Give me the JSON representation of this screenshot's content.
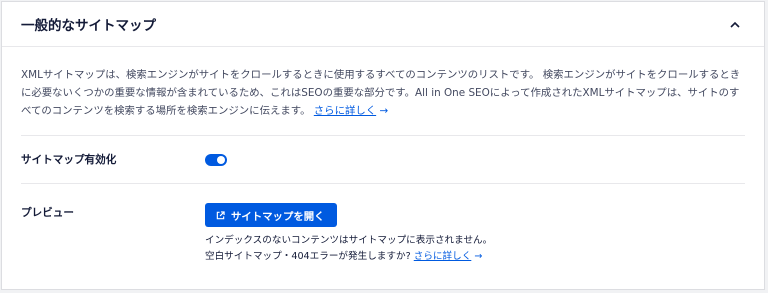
{
  "header": {
    "title": "一般的なサイトマップ"
  },
  "description": {
    "text": "XMLサイトマップは、検索エンジンがサイトをクロールするときに使用するすべてのコンテンツのリストです。 検索エンジンがサイトをクロールするときに必要ないくつかの重要な情報が含まれているため、これはSEOの重要な部分です。All in One SEOによって作成されたXMLサイトマップは、サイトのすべてのコンテンツを検索する場所を検索エンジンに伝えます。",
    "link": "さらに詳しく",
    "arrow": "→"
  },
  "enable_sitemap": {
    "label": "サイトマップ有効化",
    "enabled": true
  },
  "preview": {
    "label": "プレビュー",
    "button_label": "サイトマップを開く",
    "help_line1": "インデックスのないコンテンツはサイトマップに表示されません。",
    "help_line2": "空白サイトマップ・404エラーが発生しますか?",
    "help_link": "さらに詳しく",
    "help_arrow": "→"
  },
  "colors": {
    "accent": "#005ae0",
    "title": "#141b38",
    "body_text": "#434960"
  },
  "icons": {
    "collapse": "chevron-up-icon",
    "open_external": "external-link-icon"
  }
}
